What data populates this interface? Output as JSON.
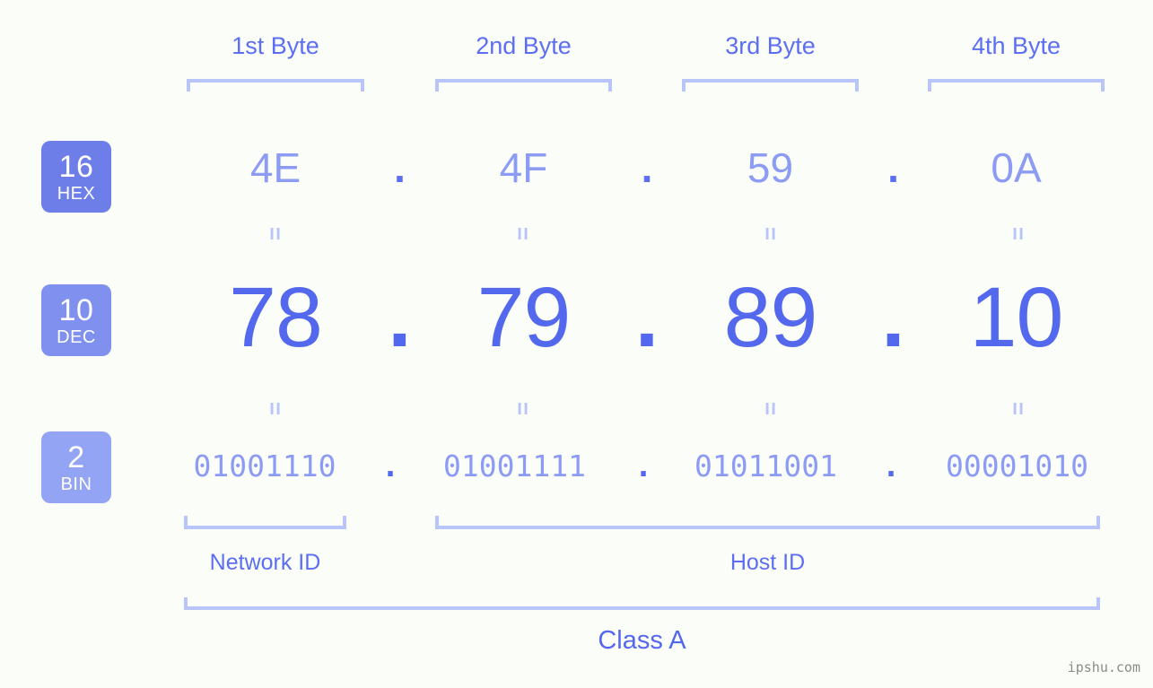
{
  "background_color": "#fbfdf8",
  "accent_color": "#5468ee",
  "accent_light_color": "#8c9bf3",
  "bracket_color": "#b9c4f8",
  "byte_headers": [
    {
      "label": "1st Byte"
    },
    {
      "label": "2nd Byte"
    },
    {
      "label": "3rd Byte"
    },
    {
      "label": "4th Byte"
    }
  ],
  "rows": {
    "hex": {
      "badge_number": "16",
      "badge_name": "HEX",
      "badge_color": "#6e7ee8",
      "values": [
        "4E",
        "4F",
        "59",
        "0A"
      ],
      "separator": "."
    },
    "dec": {
      "badge_number": "10",
      "badge_name": "DEC",
      "badge_color": "#8090ee",
      "values": [
        "78",
        "79",
        "89",
        "10"
      ],
      "separator": "."
    },
    "bin": {
      "badge_number": "2",
      "badge_name": "BIN",
      "badge_color": "#93a4f5",
      "values": [
        "01001110",
        "01001111",
        "01011001",
        "00001010"
      ],
      "separator": "."
    }
  },
  "equals_glyph": "=",
  "sections": {
    "network_id": "Network ID",
    "host_id": "Host ID",
    "class": "Class A"
  },
  "watermark": "ipshu.com"
}
